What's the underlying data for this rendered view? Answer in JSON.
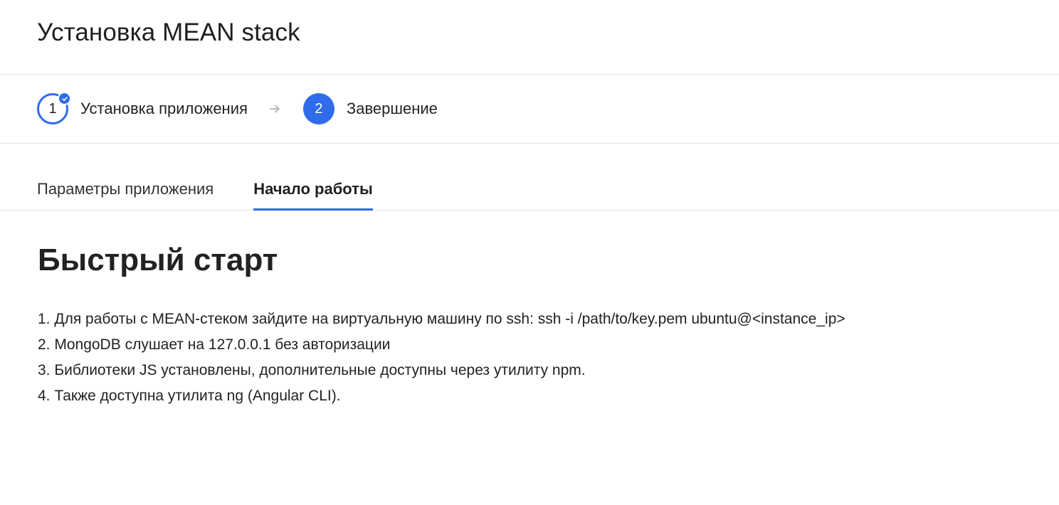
{
  "header": {
    "title": "Установка MEAN stack"
  },
  "stepper": {
    "steps": [
      {
        "number": "1",
        "label": "Установка приложения",
        "state": "done"
      },
      {
        "number": "2",
        "label": "Завершение",
        "state": "active"
      }
    ],
    "separator_icon": "arrow-right-icon",
    "done_icon": "check-icon"
  },
  "tabs": [
    {
      "label": "Параметры приложения",
      "active": false
    },
    {
      "label": "Начало работы",
      "active": true
    }
  ],
  "main": {
    "heading": "Быстрый старт",
    "items": [
      "1. Для работы с MEAN-стеком зайдите на виртуальную машину по ssh: ssh -i /path/to/key.pem ubuntu@<instance_ip>",
      "2. MongoDB слушает на 127.0.0.1 без авторизации",
      "3. Библиотеки JS установлены, дополнительные доступны через утилиту npm.",
      "4. Также доступна утилита ng (Angular CLI)."
    ]
  },
  "colors": {
    "accent": "#2f6bea",
    "divider": "#e4e6e9",
    "arrow": "#b5b9bf"
  }
}
